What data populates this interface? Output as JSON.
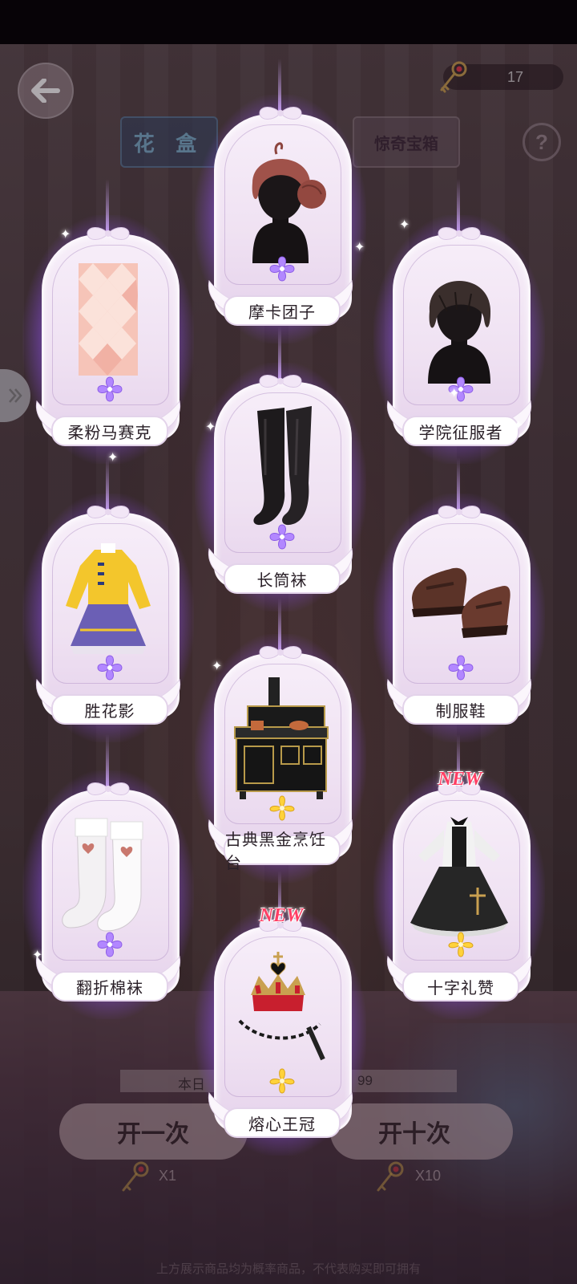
{
  "top": {
    "key_count": "17",
    "tabs": [
      {
        "label": "花 盒"
      },
      {
        "label": "惊奇宝箱"
      }
    ],
    "help_label": "?"
  },
  "rewards": [
    {
      "name": "摩卡团子",
      "icon": "hair-bun-icon",
      "badge": "purple-flower",
      "new": false
    },
    {
      "name": "柔粉马赛克",
      "icon": "pink-mosaic-backdrop-icon",
      "badge": "purple-flower",
      "new": false
    },
    {
      "name": "学院征服者",
      "icon": "short-hair-icon",
      "badge": "purple-flower",
      "new": false
    },
    {
      "name": "长筒袜",
      "icon": "stockings-icon",
      "badge": "purple-flower",
      "new": false
    },
    {
      "name": "胜花影",
      "icon": "yellow-dress-icon",
      "badge": "purple-flower",
      "new": false
    },
    {
      "name": "制服鞋",
      "icon": "loafers-icon",
      "badge": "purple-flower",
      "new": false
    },
    {
      "name": "古典黑金烹饪台",
      "icon": "stove-icon",
      "badge": "gold-flower",
      "new": false
    },
    {
      "name": "翻折棉袜",
      "icon": "socks-icon",
      "badge": "purple-flower",
      "new": false
    },
    {
      "name": "十字礼赞",
      "icon": "gothic-dress-icon",
      "badge": "gold-flower",
      "new": true,
      "new_label": "NEW"
    },
    {
      "name": "熔心王冠",
      "icon": "crown-icon",
      "badge": "gold-flower",
      "new": true,
      "new_label": "NEW"
    }
  ],
  "bottom": {
    "daily_prefix": "本日",
    "daily_suffix": "99",
    "open_once_label": "开一次",
    "open_ten_label": "开十次",
    "cost_once": "X1",
    "cost_ten": "X10",
    "disclaimer": "上方展示商品均为概率商品，不代表购买即可拥有"
  },
  "colors": {
    "glow": "#a86cff",
    "new_tag": "#ff3e64",
    "purple_flower": "#b287ff",
    "gold_flower": "#ffd23a"
  }
}
